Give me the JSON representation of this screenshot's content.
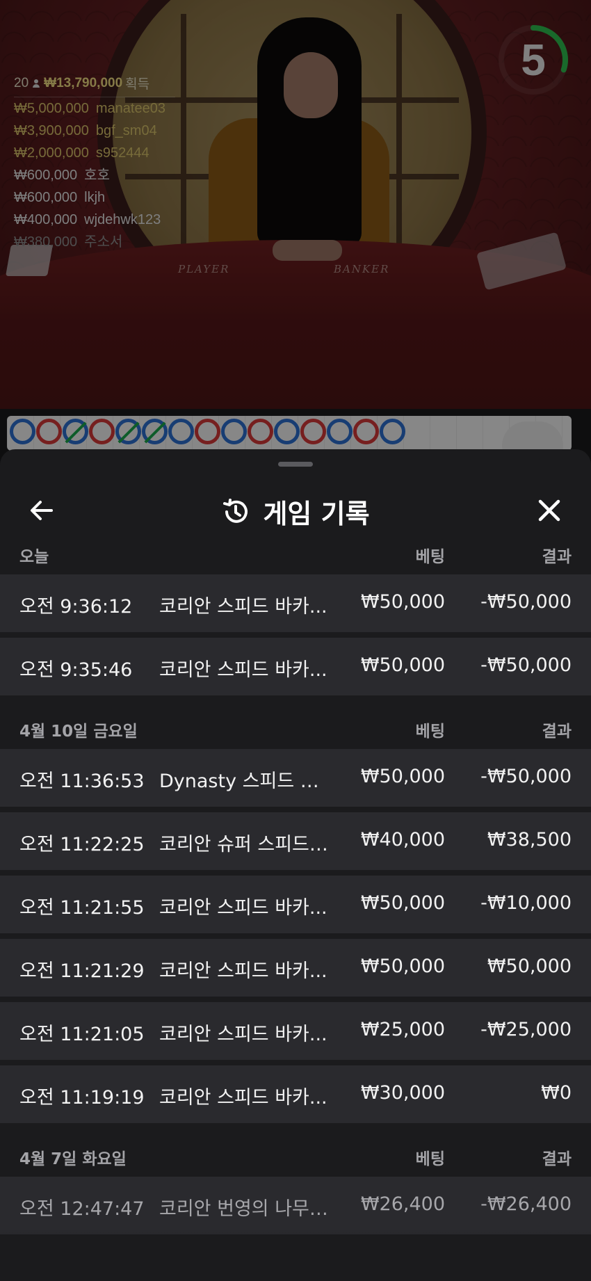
{
  "live": {
    "table_labels": {
      "player": "PLAYER",
      "banker": "BANKER"
    },
    "countdown": "5",
    "countdown_progress": 0.3,
    "winners": {
      "count": "20",
      "total": "₩13,790,000",
      "suffix": "획득",
      "list": [
        {
          "amount": "₩5,000,000",
          "name": "manatee03",
          "tier": "gold"
        },
        {
          "amount": "₩3,900,000",
          "name": "bgf_sm04",
          "tier": "gold"
        },
        {
          "amount": "₩2,000,000",
          "name": "s952444",
          "tier": "gold"
        },
        {
          "amount": "₩600,000",
          "name": "호호",
          "tier": "white"
        },
        {
          "amount": "₩600,000",
          "name": "lkjh",
          "tier": "white"
        },
        {
          "amount": "₩400,000",
          "name": "wjdehwk123",
          "tier": "white"
        },
        {
          "amount": "₩380,000",
          "name": "주소서",
          "tier": "fade"
        }
      ]
    },
    "road": [
      "P",
      "B",
      "T",
      "B",
      "T",
      "T",
      "P",
      "B",
      "P",
      "B",
      "P",
      "B",
      "P",
      "B",
      "P"
    ]
  },
  "sheet": {
    "title": "게임 기록",
    "back_icon": "arrow-left-icon",
    "history_icon": "history-icon",
    "close_icon": "close-icon",
    "sections": [
      {
        "date": "오늘",
        "bet_header": "베팅",
        "result_header": "결과",
        "rows": [
          {
            "time": "오전 9:36:12",
            "game": "코리안 스피드 바카...",
            "bet": "₩50,000",
            "result": "-₩50,000"
          },
          {
            "time": "오전 9:35:46",
            "game": "코리안 스피드 바카...",
            "bet": "₩50,000",
            "result": "-₩50,000"
          }
        ]
      },
      {
        "date": "4월 10일 금요일",
        "bet_header": "베팅",
        "result_header": "결과",
        "rows": [
          {
            "time": "오전 11:36:53",
            "game": "Dynasty 스피드 바...",
            "bet": "₩50,000",
            "result": "-₩50,000"
          },
          {
            "time": "오전 11:22:25",
            "game": "코리안 슈퍼 스피드 ...",
            "bet": "₩40,000",
            "result": "₩38,500"
          },
          {
            "time": "오전 11:21:55",
            "game": "코리안 스피드 바카...",
            "bet": "₩50,000",
            "result": "-₩10,000"
          },
          {
            "time": "오전 11:21:29",
            "game": "코리안 스피드 바카...",
            "bet": "₩50,000",
            "result": "₩50,000"
          },
          {
            "time": "오전 11:21:05",
            "game": "코리안 스피드 바카...",
            "bet": "₩25,000",
            "result": "-₩25,000"
          },
          {
            "time": "오전 11:19:19",
            "game": "코리안 스피드 바카...",
            "bet": "₩30,000",
            "result": "₩0"
          }
        ]
      },
      {
        "date": "4월 7일 화요일",
        "bet_header": "베팅",
        "result_header": "결과",
        "rows": [
          {
            "time": "오전 12:47:47",
            "game": "코리안 번영의 나무 ...",
            "bet": "₩26,400",
            "result": "-₩26,400"
          }
        ]
      }
    ]
  }
}
